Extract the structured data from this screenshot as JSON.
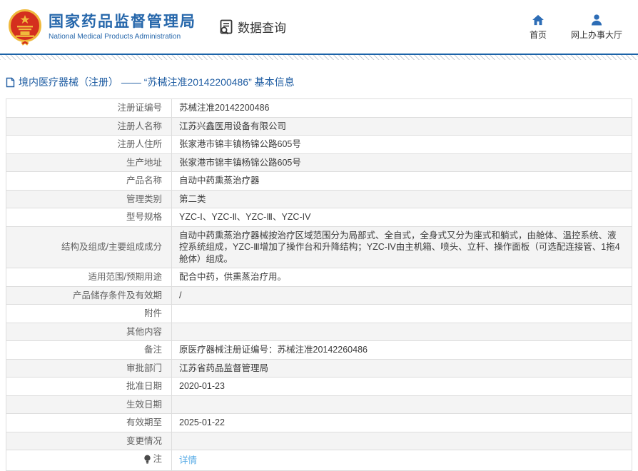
{
  "header": {
    "agency_name_cn": "国家药品监督管理局",
    "agency_name_en": "National Medical Products Administration",
    "data_query": "数据查询",
    "nav_home": "首页",
    "nav_hall": "网上办事大厅"
  },
  "breadcrumb": "境内医疗器械（注册） —— “苏械注准20142200486” 基本信息",
  "detail_table": {
    "rows": [
      {
        "label": "注册证编号",
        "value": "苏械注准20142200486"
      },
      {
        "label": "注册人名称",
        "value": "江苏兴鑫医用设备有限公司"
      },
      {
        "label": "注册人住所",
        "value": "张家港市锦丰镇杨锦公路605号"
      },
      {
        "label": "生产地址",
        "value": "张家港市锦丰镇杨锦公路605号"
      },
      {
        "label": "产品名称",
        "value": "自动中药熏蒸治疗器"
      },
      {
        "label": "管理类别",
        "value": "第二类"
      },
      {
        "label": "型号规格",
        "value": "YZC-Ⅰ、YZC-Ⅱ、YZC-Ⅲ、YZC-IV"
      },
      {
        "label": "结构及组成/主要组成成分",
        "value": "自动中药熏蒸治疗器械按治疗区域范围分为局部式、全自式，全身式又分为座式和躺式，由舱体、温控系统、液控系统组成，YZC-Ⅲ增加了操作台和升降结构；YZC-IV由主机箱、喷头、立杆、操作面板（可选配连接管、1拖4舱体）组成。"
      },
      {
        "label": "适用范围/预期用途",
        "value": "配合中药，供熏蒸治疗用。"
      },
      {
        "label": "产品储存条件及有效期",
        "value": "/"
      },
      {
        "label": "附件",
        "value": ""
      },
      {
        "label": "其他内容",
        "value": ""
      },
      {
        "label": "备注",
        "value": "原医疗器械注册证编号：苏械注准20142260486"
      },
      {
        "label": "审批部门",
        "value": "江苏省药品监督管理局"
      },
      {
        "label": "批准日期",
        "value": "2020-01-23"
      },
      {
        "label": "生效日期",
        "value": ""
      },
      {
        "label": "有效期至",
        "value": "2025-01-22"
      },
      {
        "label": "变更情况",
        "value": ""
      },
      {
        "label": "注",
        "value": "详情",
        "is_link": true,
        "has_bulb_icon": true
      }
    ]
  },
  "colors": {
    "brand_blue": "#2667ab",
    "rule_blue": "#1b62a8",
    "link_blue": "#55aae6",
    "stripe_gray": "#f4f4f4",
    "border_gray": "#dddddd",
    "emblem_red": "#d42f1e",
    "emblem_gold": "#f0b93c"
  }
}
